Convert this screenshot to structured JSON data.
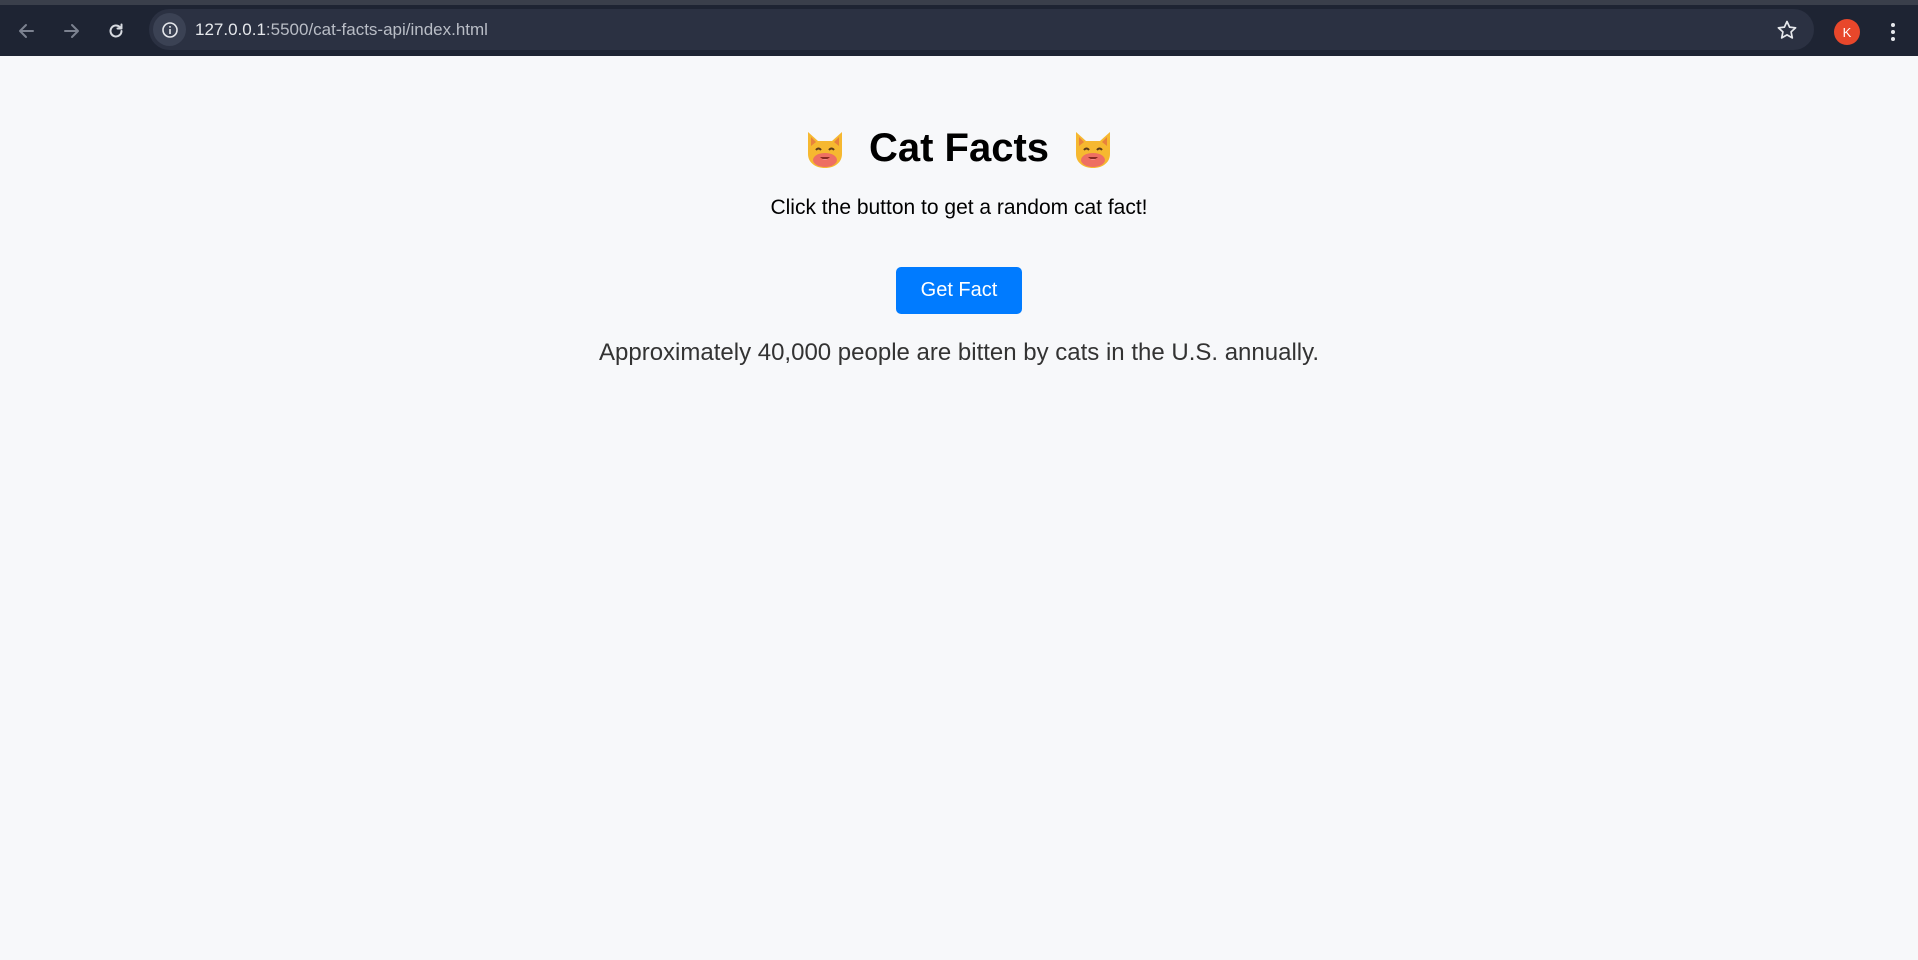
{
  "browser": {
    "url_host": "127.0.0.1",
    "url_path": ":5500/cat-facts-api/index.html",
    "avatar_letter": "K",
    "icons": {
      "back": "arrow-left-icon",
      "forward": "arrow-right-icon",
      "reload": "reload-icon",
      "site_info": "info-icon",
      "bookmark": "star-icon",
      "menu": "kebab-menu-icon"
    }
  },
  "page": {
    "title": "Cat Facts",
    "subtitle": "Click the button to get a random cat fact!",
    "button_label": "Get Fact",
    "fact": "Approximately 40,000 people are bitten by cats in the U.S. annually.",
    "title_icon": "cat-face-emoji"
  },
  "colors": {
    "button": "#007bff",
    "avatar": "#e8472b",
    "toolbar": "#1e2433"
  }
}
